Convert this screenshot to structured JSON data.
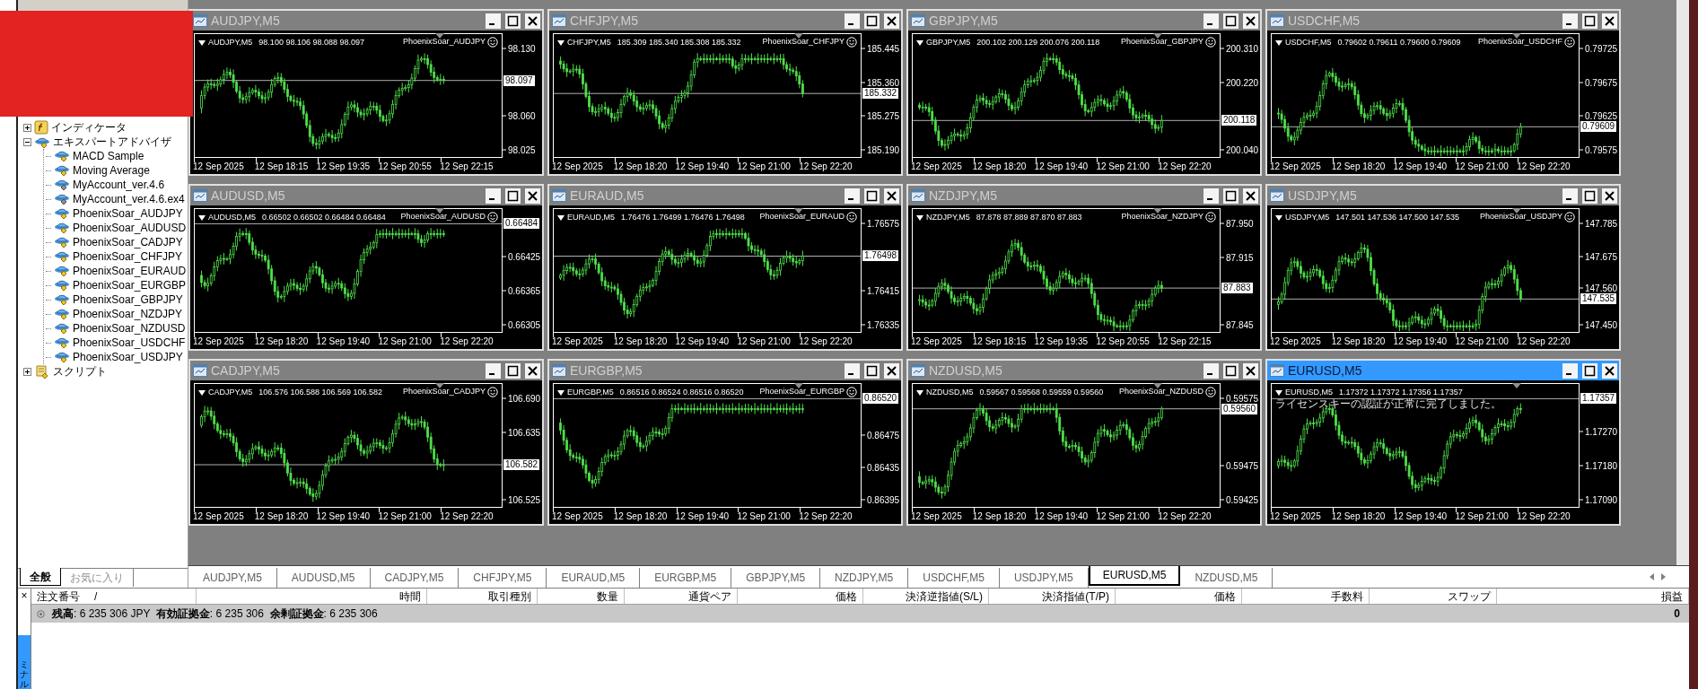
{
  "navigator": {
    "tree": [
      {
        "label": "インディケータ",
        "kind": "indicator",
        "expanded": false
      },
      {
        "label": "エキスパートアドバイザ",
        "kind": "experts",
        "expanded": true,
        "children": [
          {
            "label": "MACD Sample",
            "kind": "expert"
          },
          {
            "label": "Moving Average",
            "kind": "expert"
          },
          {
            "label": "MyAccount_ver.4.6",
            "kind": "compiled"
          },
          {
            "label": "MyAccount_ver.4.6.ex4",
            "kind": "compiled"
          },
          {
            "label": "PhoenixSoar_AUDJPY",
            "kind": "expert"
          },
          {
            "label": "PhoenixSoar_AUDUSD",
            "kind": "expert"
          },
          {
            "label": "PhoenixSoar_CADJPY",
            "kind": "expert"
          },
          {
            "label": "PhoenixSoar_CHFJPY",
            "kind": "expert"
          },
          {
            "label": "PhoenixSoar_EURAUD",
            "kind": "expert"
          },
          {
            "label": "PhoenixSoar_EURGBP",
            "kind": "expert"
          },
          {
            "label": "PhoenixSoar_GBPJPY",
            "kind": "expert"
          },
          {
            "label": "PhoenixSoar_NZDJPY",
            "kind": "expert"
          },
          {
            "label": "PhoenixSoar_NZDUSD",
            "kind": "expert"
          },
          {
            "label": "PhoenixSoar_USDCHF",
            "kind": "expert"
          },
          {
            "label": "PhoenixSoar_USDJPY",
            "kind": "expert"
          }
        ]
      },
      {
        "label": "スクリプト",
        "kind": "scripts",
        "expanded": false
      }
    ],
    "tabs": [
      {
        "label": "全般",
        "selected": true
      },
      {
        "label": "お気に入り",
        "selected": false
      }
    ]
  },
  "charts": [
    {
      "title": "AUDJPY,M5",
      "active": false,
      "symbol": "AUDJPY,M5",
      "ohlc": "98.100 98.106 98.088 98.097",
      "expert": "PhoenixSoar_AUDJPY",
      "price_ticks": [
        "98.130",
        "98.060",
        "98.025"
      ],
      "current_price": "98.097",
      "time_labels": [
        "12 Sep 2025",
        "12 Sep 18:15",
        "12 Sep 19:35",
        "12 Sep 20:55",
        "12 Sep 22:15"
      ]
    },
    {
      "title": "CHFJPY,M5",
      "active": false,
      "symbol": "CHFJPY,M5",
      "ohlc": "185.309 185.340 185.308 185.332",
      "expert": "PhoenixSoar_CHFJPY",
      "price_ticks": [
        "185.445",
        "185.360",
        "185.275",
        "185.190"
      ],
      "current_price": "185.332",
      "time_labels": [
        "12 Sep 2025",
        "12 Sep 18:20",
        "12 Sep 19:40",
        "12 Sep 21:00",
        "12 Sep 22:20"
      ]
    },
    {
      "title": "GBPJPY,M5",
      "active": false,
      "symbol": "GBPJPY,M5",
      "ohlc": "200.102 200.129 200.076 200.118",
      "expert": "PhoenixSoar_GBPJPY",
      "price_ticks": [
        "200.310",
        "200.220",
        "200.040"
      ],
      "current_price": "200.118",
      "time_labels": [
        "12 Sep 2025",
        "12 Sep 18:20",
        "12 Sep 19:40",
        "12 Sep 21:00",
        "12 Sep 22:20"
      ]
    },
    {
      "title": "USDCHF,M5",
      "active": false,
      "symbol": "USDCHF,M5",
      "ohlc": "0.79602 0.79611 0.79600 0.79609",
      "expert": "PhoenixSoar_USDCHF",
      "price_ticks": [
        "0.79725",
        "0.79675",
        "0.79625",
        "0.79575"
      ],
      "current_price": "0.79609",
      "time_labels": [
        "12 Sep 2025",
        "12 Sep 18:20",
        "12 Sep 19:40",
        "12 Sep 21:00",
        "12 Sep 22:20"
      ]
    },
    {
      "title": "AUDUSD,M5",
      "active": false,
      "symbol": "AUDUSD,M5",
      "ohlc": "0.66502 0.66502 0.66484 0.66484",
      "expert": "PhoenixSoar_AUDUSD",
      "price_ticks": [
        "0.66425",
        "0.66365",
        "0.66305"
      ],
      "current_price": "0.66484",
      "time_labels": [
        "12 Sep 2025",
        "12 Sep 18:20",
        "12 Sep 19:40",
        "12 Sep 21:00",
        "12 Sep 22:20"
      ]
    },
    {
      "title": "EURAUD,M5",
      "active": false,
      "symbol": "EURAUD,M5",
      "ohlc": "1.76476 1.76499 1.76476 1.76498",
      "expert": "PhoenixSoar_EURAUD",
      "price_ticks": [
        "1.76575",
        "1.76415",
        "1.76335"
      ],
      "current_price": "1.76498",
      "time_labels": [
        "12 Sep 2025",
        "12 Sep 18:20",
        "12 Sep 19:40",
        "12 Sep 21:00",
        "12 Sep 22:20"
      ]
    },
    {
      "title": "NZDJPY,M5",
      "active": false,
      "symbol": "NZDJPY,M5",
      "ohlc": "87.878 87.889 87.870 87.883",
      "expert": "PhoenixSoar_NZDJPY",
      "price_ticks": [
        "87.950",
        "87.915",
        "87.845"
      ],
      "current_price": "87.883",
      "time_labels": [
        "12 Sep 2025",
        "12 Sep 18:15",
        "12 Sep 19:35",
        "12 Sep 20:55",
        "12 Sep 22:15"
      ]
    },
    {
      "title": "USDJPY,M5",
      "active": false,
      "symbol": "USDJPY,M5",
      "ohlc": "147.501 147.536 147.500 147.535",
      "expert": "PhoenixSoar_USDJPY",
      "price_ticks": [
        "147.785",
        "147.675",
        "147.560",
        "147.450"
      ],
      "current_price": "147.535",
      "time_labels": [
        "12 Sep 2025",
        "12 Sep 18:20",
        "12 Sep 19:40",
        "12 Sep 21:00",
        "12 Sep 22:20"
      ]
    },
    {
      "title": "CADJPY,M5",
      "active": false,
      "symbol": "CADJPY,M5",
      "ohlc": "106.576 106.588 106.569 106.582",
      "expert": "PhoenixSoar_CADJPY",
      "price_ticks": [
        "106.690",
        "106.635",
        "106.525"
      ],
      "current_price": "106.582",
      "time_labels": [
        "12 Sep 2025",
        "12 Sep 18:20",
        "12 Sep 19:40",
        "12 Sep 21:00",
        "12 Sep 22:20"
      ]
    },
    {
      "title": "EURGBP,M5",
      "active": false,
      "symbol": "EURGBP,M5",
      "ohlc": "0.86516 0.86524 0.86516 0.86520",
      "expert": "PhoenixSoar_EURGBP",
      "price_ticks": [
        "0.86475",
        "0.86435",
        "0.86395"
      ],
      "current_price": "0.86520",
      "time_labels": [
        "12 Sep 2025",
        "12 Sep 18:20",
        "12 Sep 19:40",
        "12 Sep 21:00",
        "12 Sep 22:20"
      ]
    },
    {
      "title": "NZDUSD,M5",
      "active": false,
      "symbol": "NZDUSD,M5",
      "ohlc": "0.59567 0.59568 0.59559 0.59560",
      "expert": "PhoenixSoar_NZDUSD",
      "price_ticks": [
        "0.59575",
        "0.59475",
        "0.59425"
      ],
      "current_price": "0.59560",
      "time_labels": [
        "12 Sep 2025",
        "12 Sep 18:20",
        "12 Sep 19:40",
        "12 Sep 21:00",
        "12 Sep 22:20"
      ]
    },
    {
      "title": "EURUSD,M5",
      "active": true,
      "symbol": "EURUSD,M5",
      "ohlc": "1.17372 1.17372 1.17356 1.17357",
      "message": "ライセンスキーの認証が正常に完了しました。",
      "price_ticks": [
        "1.17270",
        "1.17180",
        "1.17090"
      ],
      "current_price": "1.17357",
      "time_labels": [
        "12 Sep 2025",
        "12 Sep 18:20",
        "12 Sep 19:40",
        "12 Sep 21:00",
        "12 Sep 22:20"
      ]
    }
  ],
  "chart_tabs": [
    {
      "label": "AUDJPY,M5",
      "selected": false
    },
    {
      "label": "AUDUSD,M5",
      "selected": false
    },
    {
      "label": "CADJPY,M5",
      "selected": false
    },
    {
      "label": "CHFJPY,M5",
      "selected": false
    },
    {
      "label": "EURAUD,M5",
      "selected": false
    },
    {
      "label": "EURGBP,M5",
      "selected": false
    },
    {
      "label": "GBPJPY,M5",
      "selected": false
    },
    {
      "label": "NZDJPY,M5",
      "selected": false
    },
    {
      "label": "USDCHF,M5",
      "selected": false
    },
    {
      "label": "USDJPY,M5",
      "selected": false
    },
    {
      "label": "EURUSD,M5",
      "selected": true
    },
    {
      "label": "NZDUSD,M5",
      "selected": false
    }
  ],
  "terminal": {
    "close": "×",
    "side_label": "ミナル",
    "sort_mark": "/",
    "columns": [
      "注文番号",
      "時間",
      "取引種別",
      "数量",
      "通貨ペア",
      "価格",
      "決済逆指値(S/L)",
      "決済指値(T/P)",
      "価格",
      "手数料",
      "スワップ",
      "損益"
    ],
    "summary": "**残高**: 6 235 306 JPY  **有効証拠金**: 6 235 306  **余剰証拠金**: 6 235 306",
    "profit": "0"
  }
}
